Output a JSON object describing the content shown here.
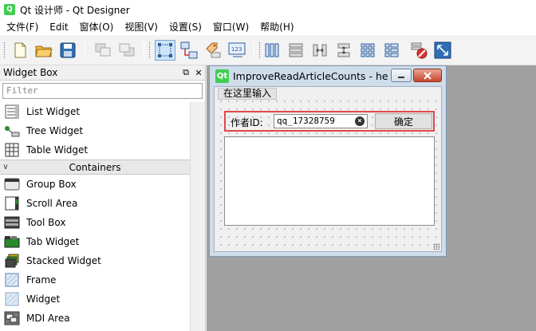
{
  "app": {
    "title": "Qt 设计师 - Qt Designer",
    "logo": "Q"
  },
  "menu": [
    "文件(F)",
    "Edit",
    "窗体(O)",
    "视图(V)",
    "设置(S)",
    "窗口(W)",
    "帮助(H)"
  ],
  "widget_box": {
    "title": "Widget Box",
    "float_label": "⧉",
    "close_label": "✕",
    "filter_placeholder": "Filter",
    "items_top": [
      {
        "label": "List Widget",
        "icon": "list-widget-icon"
      },
      {
        "label": "Tree Widget",
        "icon": "tree-widget-icon"
      },
      {
        "label": "Table Widget",
        "icon": "table-widget-icon"
      }
    ],
    "category": {
      "label": "Containers",
      "arrow": "∨"
    },
    "items_containers": [
      {
        "label": "Group Box",
        "icon": "group-box-icon"
      },
      {
        "label": "Scroll Area",
        "icon": "scroll-area-icon"
      },
      {
        "label": "Tool Box",
        "icon": "tool-box-icon"
      },
      {
        "label": "Tab Widget",
        "icon": "tab-widget-icon"
      },
      {
        "label": "Stacked Widget",
        "icon": "stacked-widget-icon"
      },
      {
        "label": "Frame",
        "icon": "frame-icon"
      },
      {
        "label": "Widget",
        "icon": "widget-icon"
      },
      {
        "label": "MDI Area",
        "icon": "mdi-area-icon"
      }
    ]
  },
  "form": {
    "logo": "Qt",
    "title": "ImproveReadArticleCounts - he...",
    "menu_item": "在这里输入",
    "author_label": "作者ID:",
    "author_value": "qq_17328759",
    "clear_glyph": "×",
    "ok_button": "确定"
  },
  "colors": {
    "accent": "#41cd52",
    "highlight_border": "#e0474c",
    "workspace": "#a0a0a0"
  }
}
